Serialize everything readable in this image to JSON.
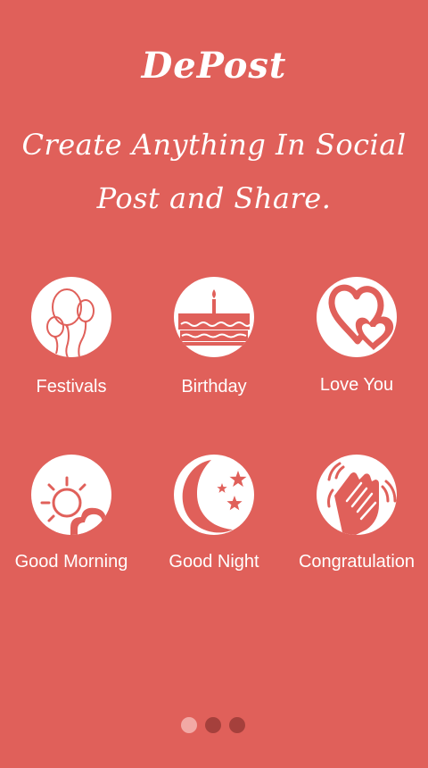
{
  "header": {
    "app_title": "DePost",
    "tagline_line1": "Create Anything In Social",
    "tagline_line2": "Post and Share."
  },
  "categories": [
    {
      "label": "Festivals",
      "icon": "balloons-icon"
    },
    {
      "label": "Birthday",
      "icon": "birthday-cake-icon"
    },
    {
      "label": "Love You",
      "icon": "hearts-icon"
    },
    {
      "label": "Good Morning",
      "icon": "sun-cloud-icon"
    },
    {
      "label": "Good Night",
      "icon": "moon-stars-icon"
    },
    {
      "label": "Congratulation",
      "icon": "clapping-hands-icon"
    }
  ],
  "pagination": {
    "total_pages": 3,
    "active_page": 1
  },
  "colors": {
    "background": "#e0605a",
    "icon_circle": "#ffffff",
    "dot_active": "#f2a9a5",
    "dot_inactive": "#a5403c"
  }
}
